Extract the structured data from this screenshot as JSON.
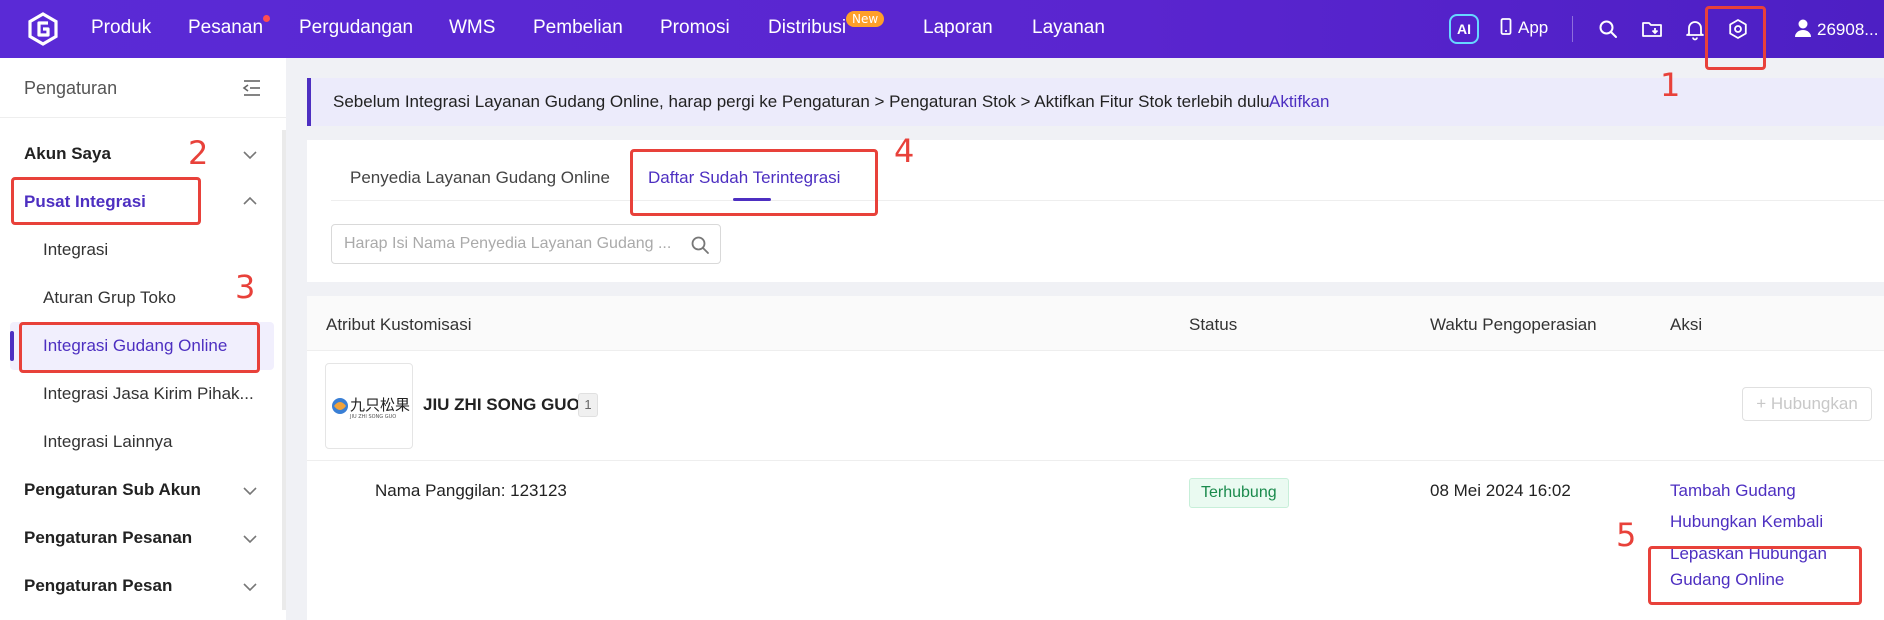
{
  "topnav": {
    "items": [
      "Produk",
      "Pesanan",
      "Pergudangan",
      "WMS",
      "Pembelian",
      "Promosi",
      "Distribusi",
      "Laporan",
      "Layanan"
    ],
    "new_badge": "New",
    "ai_label": "AI",
    "app_label": "App",
    "user_label": "26908..."
  },
  "sidebar": {
    "title": "Pengaturan",
    "groups": [
      "Akun Saya",
      "Pusat Integrasi",
      "Pengaturan Sub Akun",
      "Pengaturan Pesanan",
      "Pengaturan Pesan"
    ],
    "sub_items": [
      "Integrasi",
      "Aturan Grup Toko",
      "Integrasi Gudang Online",
      "Integrasi Jasa Kirim Pihak...",
      "Integrasi Lainnya"
    ]
  },
  "notice": {
    "text": "Sebelum Integrasi Layanan Gudang Online, harap pergi ke Pengaturan > Pengaturan Stok > Aktifkan Fitur Stok terlebih dulu",
    "link": "Aktifkan"
  },
  "tabs": [
    "Penyedia Layanan Gudang Online",
    "Daftar Sudah Terintegrasi"
  ],
  "search": {
    "placeholder": "Harap Isi Nama Penyedia Layanan Gudang ..."
  },
  "table": {
    "headers": [
      "Atribut Kustomisasi",
      "Status",
      "Waktu Pengoperasian",
      "Aksi"
    ],
    "warehouse": {
      "name": "JIU ZHI SONG GUO",
      "count": "1",
      "logo_text": "九只松果",
      "logo_subtext": "JIU ZHI SONG GUO",
      "connect_button": "+ Hubungkan"
    },
    "row": {
      "nickname": "Nama Panggilan: 123123",
      "status": "Terhubung",
      "time": "08 Mei 2024 16:02",
      "actions": [
        "Tambah Gudang",
        "Hubungkan Kembali",
        "Lepaskan Hubungan",
        "Gudang Online"
      ]
    }
  },
  "annotations": [
    "1",
    "2",
    "3",
    "4",
    "5"
  ],
  "colors": {
    "brand": "#4d2fc1",
    "topbar": "#5a2ad6",
    "annotation": "#e8413a",
    "status_green": "#1a8a4c"
  }
}
